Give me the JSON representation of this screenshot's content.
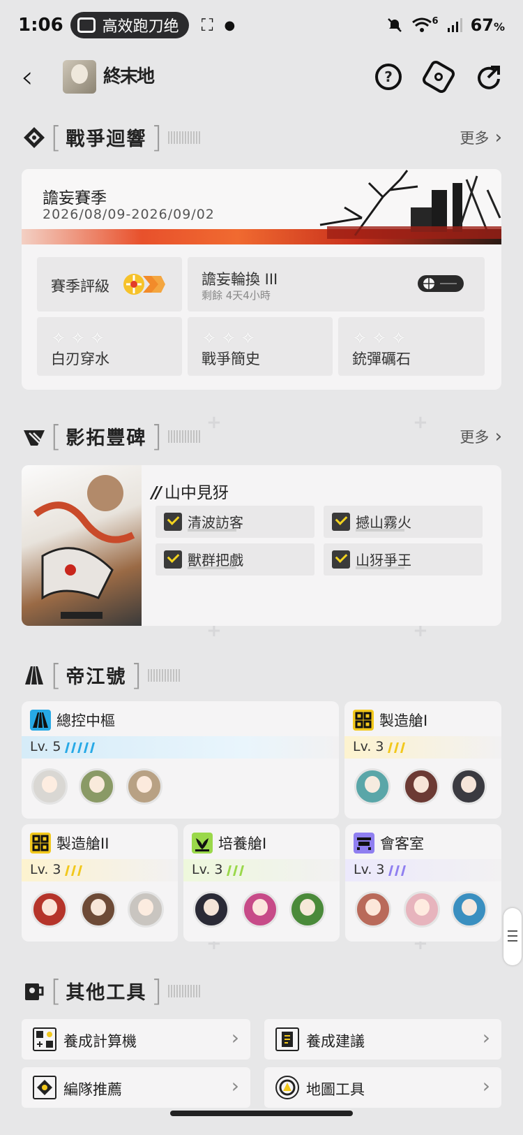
{
  "status_bar": {
    "time": "1:06",
    "notification_text": "高效跑刀绝",
    "battery": "67",
    "battery_unit": "%",
    "network_badge": "6",
    "icons": [
      "bilibili-tv-icon",
      "screenshot-icon",
      "mute-icon",
      "wifi-icon",
      "signal-icon"
    ]
  },
  "header": {
    "game_logo_text": "終末地",
    "icons": [
      "back-icon",
      "help-icon",
      "settings-icon",
      "share-icon"
    ]
  },
  "war_echo": {
    "title": "戰爭迴響",
    "more": "更多",
    "season": {
      "name": "譫妄賽季",
      "dates": "2026/08/09-2026/09/02"
    },
    "rating_label": "賽季評級",
    "rotation": {
      "label": "譫妄輪換 III",
      "remaining": "剩餘 4天4小時"
    },
    "challenges": [
      {
        "label": "白刃穿水"
      },
      {
        "label": "戰爭簡史"
      },
      {
        "label": "銃彈礪石"
      }
    ]
  },
  "monument": {
    "title": "影拓豐碑",
    "more": "更多",
    "stage_title": "山中見犽",
    "tasks": [
      {
        "label": "清波訪客",
        "done": true
      },
      {
        "label": "撼山霧火",
        "done": true
      },
      {
        "label": "獸群把戲",
        "done": true
      },
      {
        "label": "山犽爭王",
        "done": true
      }
    ]
  },
  "base": {
    "title": "帝江號",
    "rooms": [
      {
        "name": "總控中樞",
        "level": "Lv. 5",
        "color": "#27a9e6",
        "stripes": 5
      },
      {
        "name": "製造艙I",
        "level": "Lv. 3",
        "color": "#f2c81c",
        "stripes": 3
      },
      {
        "name": "製造艙II",
        "level": "Lv. 3",
        "color": "#f2c81c",
        "stripes": 3
      },
      {
        "name": "培養艙I",
        "level": "Lv. 3",
        "color": "#9ad84a",
        "stripes": 3
      },
      {
        "name": "會客室",
        "level": "Lv. 3",
        "color": "#8f7ff0",
        "stripes": 3
      }
    ]
  },
  "tools": {
    "title": "其他工具",
    "items": [
      {
        "label": "養成計算機"
      },
      {
        "label": "養成建議"
      },
      {
        "label": "編隊推薦"
      },
      {
        "label": "地圖工具"
      }
    ]
  }
}
